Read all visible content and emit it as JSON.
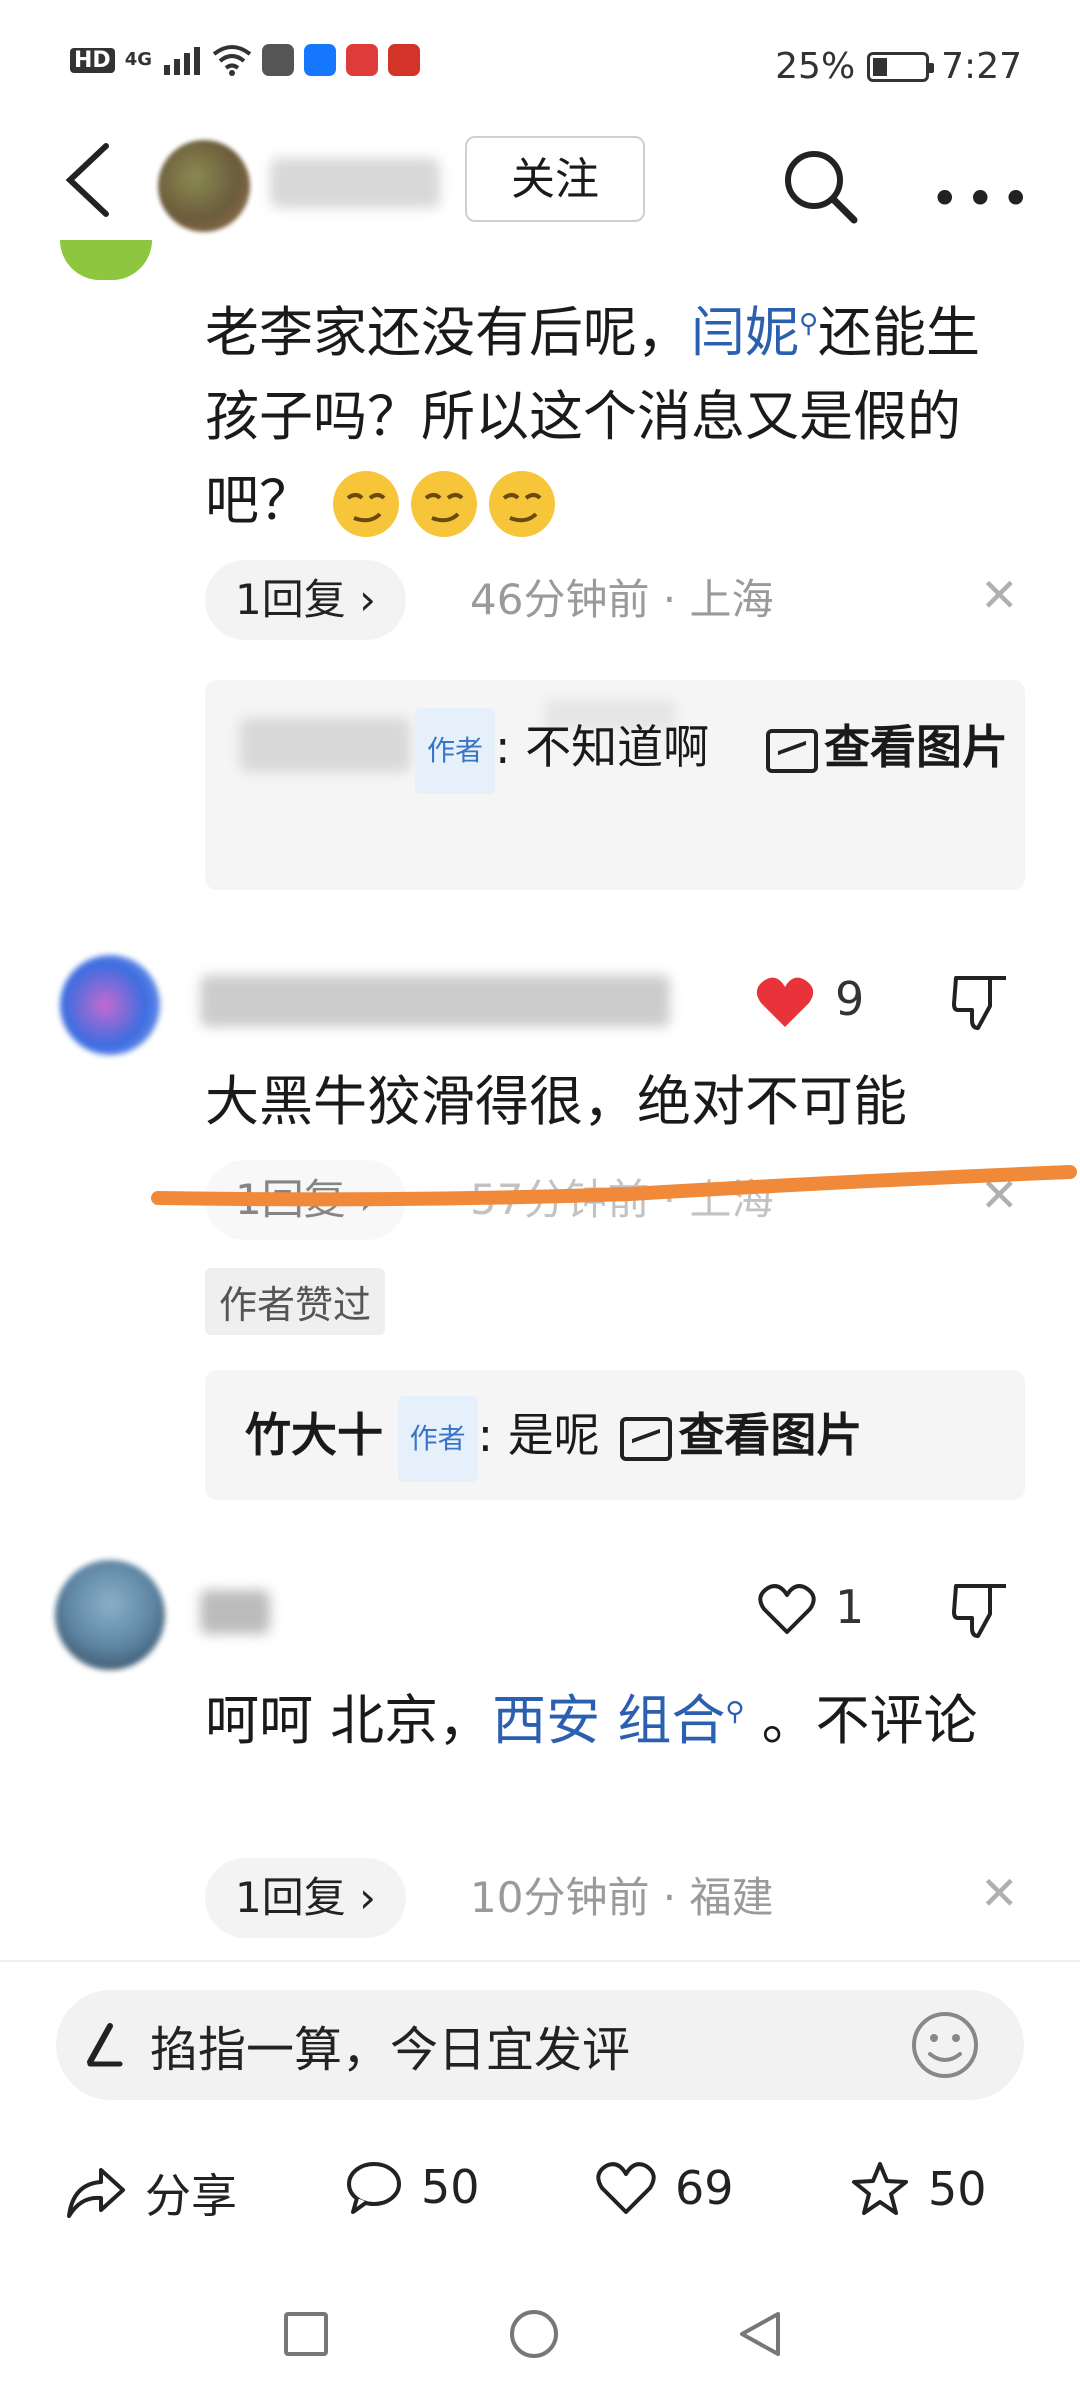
{
  "status_bar": {
    "network": "HD",
    "signal": "4G",
    "battery_percent": "25%",
    "time": "7:27"
  },
  "header": {
    "follow_label": "关注"
  },
  "comments": [
    {
      "text_part1": "老李家还没有后呢，",
      "link": "闫妮",
      "text_part2": "还能生孩子吗？所以这个消息又是假的吧？",
      "reply_label": "1回复 ›",
      "time_location": "46分钟前 · 上海",
      "sub_reply": {
        "author_tag": "作者",
        "text": ": 不知道啊",
        "view_image": "查看图片"
      }
    },
    {
      "likes": "9",
      "text": "大黑牛狡滑得很，绝对不可能",
      "reply_label": "1回复 ›",
      "time_location": "57分钟前 · 上海",
      "liked_badge": "作者赞过",
      "sub_reply": {
        "author": "竹大十",
        "author_tag": "作者",
        "text": ": 是呢",
        "view_image": "查看图片"
      }
    },
    {
      "likes": "1",
      "text_part1": "呵呵 北京，",
      "link": "西安 组合",
      "text_part2": "。不评论",
      "reply_label": "1回复 ›",
      "time_location": "10分钟前 · 福建"
    }
  ],
  "input": {
    "placeholder": "掐指一算，今日宜发评"
  },
  "toolbar": {
    "share_label": "分享",
    "comment_count": "50",
    "like_count": "69",
    "favorite_count": "50"
  },
  "colors": {
    "link": "#2b5fb0",
    "heart": "#e8333b",
    "annotation": "#f08a3a"
  }
}
